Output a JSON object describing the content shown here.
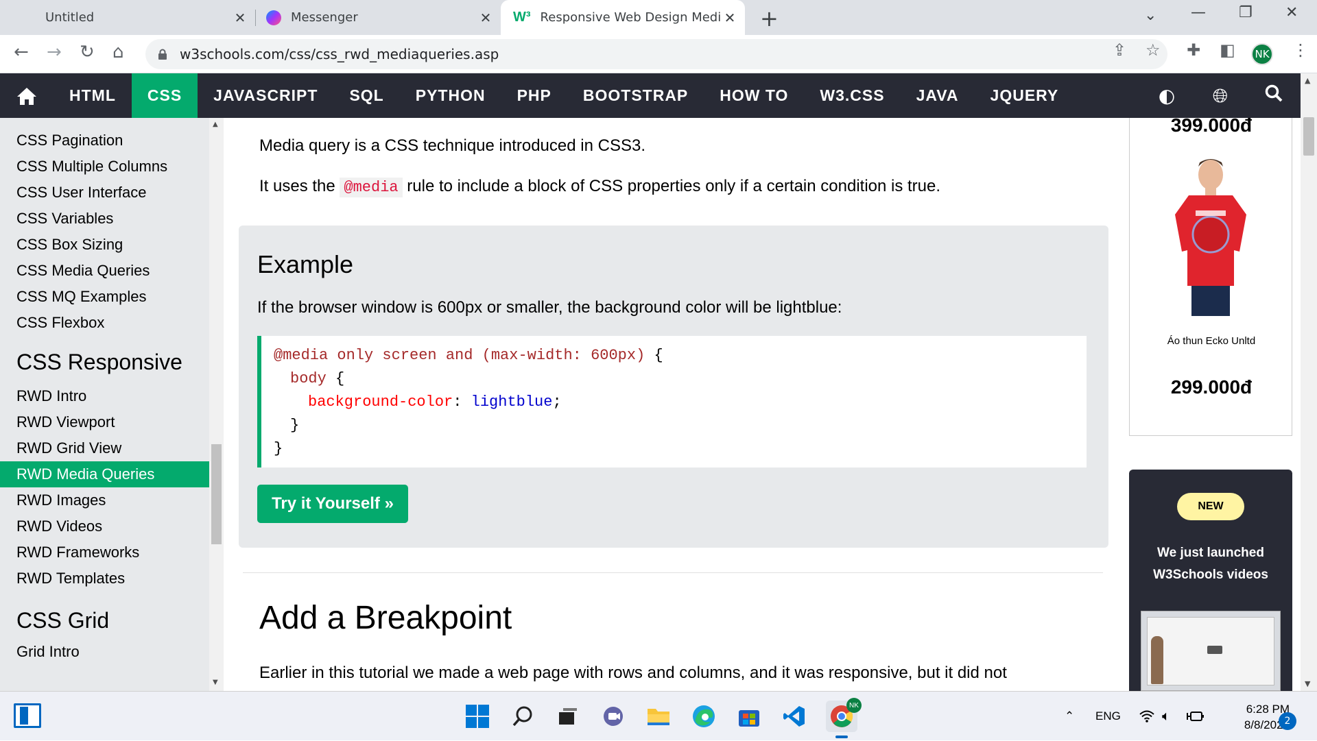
{
  "tabs": [
    {
      "title": "Untitled"
    },
    {
      "title": "Messenger"
    },
    {
      "title": "Responsive Web Design Media Q"
    }
  ],
  "address": {
    "url": "w3schools.com/css/css_rwd_mediaqueries.asp"
  },
  "profile": {
    "initials": "NK"
  },
  "topnav": {
    "items": [
      "HTML",
      "CSS",
      "JAVASCRIPT",
      "SQL",
      "PYTHON",
      "PHP",
      "BOOTSTRAP",
      "HOW TO",
      "W3.CSS",
      "JAVA",
      "JQUERY"
    ],
    "active": "CSS"
  },
  "sidebar": {
    "css_items": [
      "CSS Pagination",
      "CSS Multiple Columns",
      "CSS User Interface",
      "CSS Variables",
      "CSS Box Sizing",
      "CSS Media Queries",
      "CSS MQ Examples",
      "CSS Flexbox"
    ],
    "responsive_heading": "CSS Responsive",
    "responsive_items": [
      "RWD Intro",
      "RWD Viewport",
      "RWD Grid View",
      "RWD Media Queries",
      "RWD Images",
      "RWD Videos",
      "RWD Frameworks",
      "RWD Templates"
    ],
    "active_item": "RWD Media Queries",
    "grid_heading": "CSS Grid",
    "grid_items": [
      "Grid Intro"
    ]
  },
  "main": {
    "intro1": "Media query is a CSS technique introduced in CSS3.",
    "intro2_before": "It uses the ",
    "intro2_code": "@media",
    "intro2_after": " rule to include a block of CSS properties only if a certain condition is true.",
    "example_heading": "Example",
    "example_desc": "If the browser window is 600px or smaller, the background color will be lightblue:",
    "code": {
      "line1": "@media only screen and (max-width: 600px)",
      "line1_brace": " {",
      "line2_selector": "body",
      "line2_brace": " {",
      "line3_prop": "background-color",
      "line3_colon": ": ",
      "line3_value": "lightblue",
      "line3_semi": ";",
      "line4": "}",
      "line5": "}"
    },
    "try_button": "Try it Yourself »",
    "section_heading": "Add a Breakpoint",
    "section_text": "Earlier in this tutorial we made a web page with rows and columns, and it was responsive, but it did not"
  },
  "ads": {
    "price_top": "399.000đ",
    "product_name": "Áo thun Ecko Unltd",
    "price": "299.000đ",
    "badge": "NEW",
    "promo_line1": "We just launched",
    "promo_line2": "W3Schools videos"
  },
  "taskbar": {
    "language": "ENG",
    "time": "6:28 PM",
    "date": "8/8/2022",
    "notifications": "2"
  },
  "colors": {
    "accent": "#04aa6d",
    "nav": "#282a35",
    "sidebar": "#e7e9eb"
  }
}
